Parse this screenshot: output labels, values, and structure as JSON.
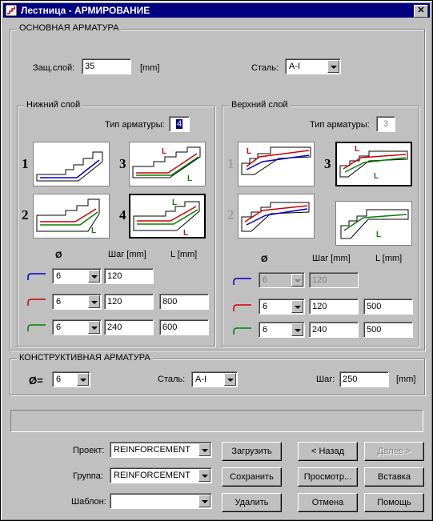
{
  "window": {
    "title": "Лестница - АРМИРОВАНИЕ",
    "close": "✕"
  },
  "main": {
    "group_label": "ОСНОВНАЯ АРМАТУРА",
    "cover_label": "Защ.слой:",
    "cover_value": "35",
    "cover_unit": "[mm]",
    "steel_label": "Сталь:",
    "steel_value": "A-I"
  },
  "lower": {
    "group_label": "Нижний слой",
    "type_label": "Тип арматуры:",
    "type_value": "4",
    "schemes": [
      "1",
      "2",
      "3",
      "4"
    ],
    "hdr_dia": "Ø",
    "hdr_step": "Шаг  [mm]",
    "hdr_len": "L  [mm]",
    "rows": [
      {
        "dia": "6",
        "step": "120",
        "len": ""
      },
      {
        "dia": "6",
        "step": "120",
        "len": "800"
      },
      {
        "dia": "6",
        "step": "240",
        "len": "600"
      }
    ]
  },
  "upper": {
    "group_label": "Верхний слой",
    "type_label": "Тип арматуры:",
    "type_value": "3",
    "schemes": [
      "1",
      "2",
      "3"
    ],
    "hdr_dia": "Ø",
    "hdr_step": "Шаг  [mm]",
    "hdr_len": "L  [mm]",
    "rows": [
      {
        "dia": "6",
        "step": "120",
        "len": ""
      },
      {
        "dia": "6",
        "step": "120",
        "len": "500"
      },
      {
        "dia": "6",
        "step": "240",
        "len": "500"
      }
    ]
  },
  "constructive": {
    "group_label": "КОНСТРУКТИВНАЯ АРМАТУРА",
    "dia_label": "Ø=",
    "dia_value": "6",
    "steel_label": "Сталь:",
    "steel_value": "A-I",
    "step_label": "Шаг:",
    "step_value": "250",
    "step_unit": "[mm]"
  },
  "bottom": {
    "project_label": "Проект:",
    "project_value": "REINFORCEMENT",
    "group_label": "Группа:",
    "group_value": "REINFORCEMENT",
    "template_label": "Шаблон:",
    "template_value": "",
    "load": "Загрузить",
    "save": "Сохранить",
    "delete": "Удалить",
    "back": "< Назад",
    "next": "Далее >",
    "preview": "Просмотр...",
    "insert": "Вставка",
    "cancel": "Отмена",
    "help": "Помощь"
  },
  "colors": {
    "title_bg": "#000080",
    "face": "#c0c0c0",
    "rebar_blue": "#0000c0",
    "rebar_red": "#d00000",
    "rebar_green": "#008000"
  },
  "icons": [
    "app-icon",
    "close-icon",
    "rebar-blue-hook-icon",
    "rebar-red-hook-icon",
    "rebar-green-hook-icon",
    "scheme-drawing"
  ]
}
